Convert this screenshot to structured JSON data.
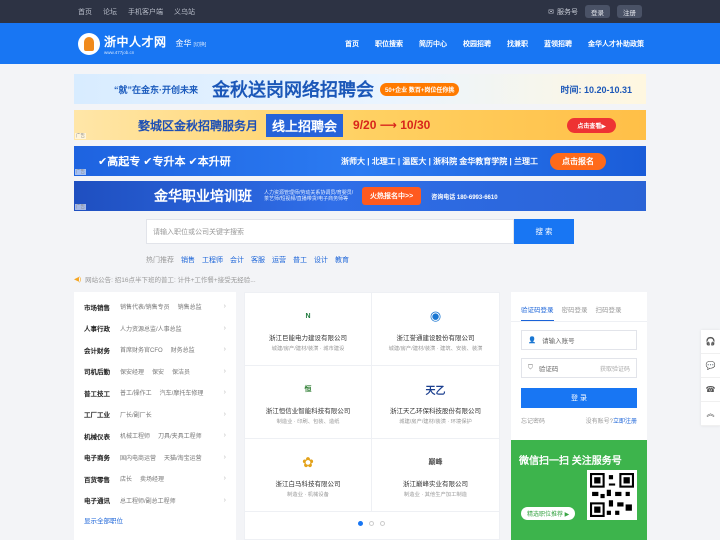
{
  "topbar": {
    "links": [
      "首页",
      "论坛",
      "手机客户端",
      "义乌站"
    ],
    "service": "服务号",
    "login": "登录",
    "register": "注册"
  },
  "header": {
    "logo": "浙中人才网",
    "logo_sub": "www.477job.cn",
    "city": "金华",
    "city_switch": "[切换]",
    "nav": [
      "首页",
      "职位搜索",
      "简历中心",
      "校园招聘",
      "找兼职",
      "蓝领招聘",
      "金华人才补助政策"
    ]
  },
  "banners": {
    "b1": {
      "t1": "“就”在金东·开创未来",
      "t2": "金秋送岗网络招聘会",
      "t3": "50+企业 数百+岗位任你挑",
      "t4": "时间: 10.20-10.31"
    },
    "b2": {
      "t1": "婺城区金秋招聘服务月",
      "t2": "线上招聘会",
      "t3": "9/20 ⟶ 10/30",
      "t4": "点击查看▶"
    },
    "b3": {
      "t1": "✔高起专 ✔专升本 ✔本升研",
      "t2": "浙师大 | 北理工 | 温医大 | 浙科院 金华教育学院 | 兰理工",
      "t4": "点击报名"
    },
    "b4": {
      "t1": "金华职业培训班",
      "t2": "人力资源管理师/劳动关系协调员/育婴员/茶艺师/短视频/直播带货/电子商务师等",
      "t3": "火热报名中>>",
      "t4": "咨询电话 180-6993-6610"
    },
    "ad": "广告"
  },
  "search": {
    "placeholder": "请输入职位或公司关键字搜索",
    "button": "搜 索",
    "hot_label": "热门推荐",
    "hot_words": [
      "销售",
      "工程师",
      "会计",
      "客服",
      "运营",
      "普工",
      "设计",
      "教育"
    ]
  },
  "notice": "网站公告: 招16点半下班的普工: 计件+工作餐+接受无经验...",
  "categories": [
    {
      "name": "市场销售",
      "subs": [
        "销售代表/销售专员",
        "销售总监"
      ]
    },
    {
      "name": "人事行政",
      "subs": [
        "人力资源总监/人事总监"
      ]
    },
    {
      "name": "会计财务",
      "subs": [
        "首席财务官CFO",
        "财务总监"
      ]
    },
    {
      "name": "司机后勤",
      "subs": [
        "保安经理",
        "保安",
        "保洁员"
      ]
    },
    {
      "name": "普工技工",
      "subs": [
        "普工/操作工",
        "汽车/摩托车修理"
      ]
    },
    {
      "name": "工厂工业",
      "subs": [
        "厂长/副厂长"
      ]
    },
    {
      "name": "机械仪表",
      "subs": [
        "机械工程师",
        "刀具/夹具工程师"
      ]
    },
    {
      "name": "电子商务",
      "subs": [
        "国内电商运营",
        "天猫/淘宝运营"
      ]
    },
    {
      "name": "百货零售",
      "subs": [
        "店长",
        "卖场经理"
      ]
    },
    {
      "name": "电子通讯",
      "subs": [
        "总工程师/副总工程师"
      ]
    }
  ],
  "categories_all": "显示全部职位",
  "companies": [
    {
      "name": "浙江巨能电力建设有限公司",
      "tags": "城建/房产/建材/装潢 · 城市建设",
      "logo": "N",
      "logo_color": "#1f7a3d"
    },
    {
      "name": "浙江誉通建设股份有限公司",
      "tags": "城建/房产/建材/装潢 · 建筑、安装、装潢",
      "logo": "◉",
      "logo_color": "#1976d2"
    },
    {
      "name": "浙江恒信业智能科技有限公司",
      "tags": "制造业 · 印刷、包装、造纸",
      "logo": "恒",
      "logo_color": "#2e7d32"
    },
    {
      "name": "浙江天乙环保科技股份有限公司",
      "tags": "城建/房产/建材/装潢 · 环境保护",
      "logo": "天乙",
      "logo_color": "#1b3f8f"
    },
    {
      "name": "浙江白马科技有限公司",
      "tags": "制造业 · 机械设备",
      "logo": "✿",
      "logo_color": "#e3a21a"
    },
    {
      "name": "浙江巅峰实业有限公司",
      "tags": "制造业 · 其他生产加工制造",
      "logo": "巅峰",
      "logo_color": "#555555"
    }
  ],
  "login": {
    "tabs": [
      "验证码登录",
      "密码登录",
      "扫码登录"
    ],
    "account_placeholder": "请输入账号",
    "code_placeholder": "验证码",
    "get_code": "获取验证码",
    "button": "登 录",
    "forgot": "忘记密码",
    "no_account": "没有账号?",
    "register": "立即注册"
  },
  "wechat": {
    "title": "微信扫一扫 关注服务号",
    "pill": "精选职位推荐 ▶"
  },
  "side": [
    "headset-icon",
    "wechat-icon",
    "phone-icon",
    "top-icon"
  ],
  "colors": {
    "brand": "#1876f3",
    "topbar": "#2d3344",
    "wechat": "#3db44c"
  }
}
